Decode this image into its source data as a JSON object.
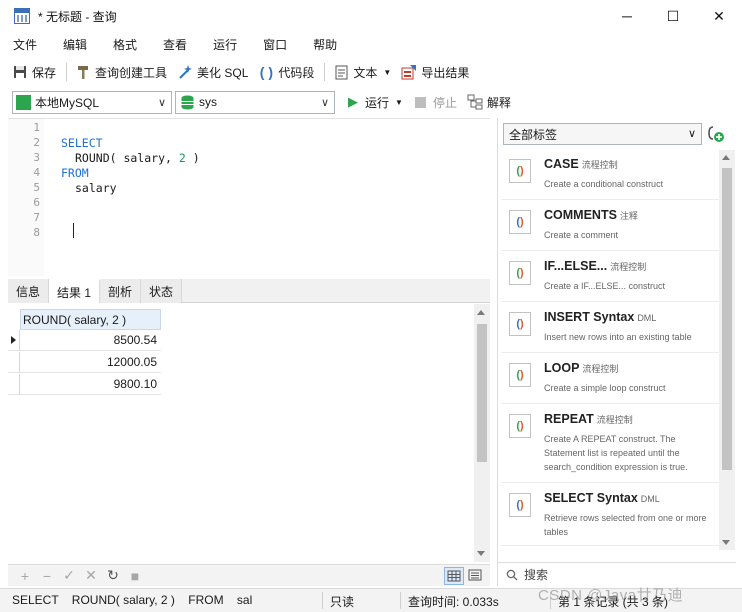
{
  "window": {
    "title": "* 无标题 - 查询",
    "minimize": "─",
    "maximize": "☐",
    "close": "✕"
  },
  "menu": [
    "文件",
    "编辑",
    "格式",
    "查看",
    "运行",
    "窗口",
    "帮助"
  ],
  "toolbar": {
    "save": "保存",
    "query_builder": "查询创建工具",
    "beautify_sql": "美化 SQL",
    "code_snippet": "代码段",
    "text": "文本",
    "export_result": "导出结果"
  },
  "toolbar2": {
    "connection": "本地MySQL",
    "database": "sys",
    "run": "运行",
    "stop": "停止",
    "explain": "解释"
  },
  "editor": {
    "lines": [
      "1",
      "2",
      "3",
      "4",
      "5",
      "6",
      "7",
      "8"
    ],
    "code": {
      "select": "SELECT",
      "round_fn": "ROUND( salary, ",
      "round_num": "2",
      "round_close": " )",
      "from": "FROM",
      "column": "salary"
    }
  },
  "result_tabs": [
    "信息",
    "结果 1",
    "剖析",
    "状态"
  ],
  "result": {
    "column": "ROUND( salary, 2 )",
    "rows": [
      "8500.54",
      "12000.05",
      "9800.10"
    ]
  },
  "grid_toolbar": {
    "add": "+",
    "remove": "−",
    "apply": "✓",
    "discard": "✕",
    "refresh": "↻",
    "stop": "■"
  },
  "snippets_panel": {
    "filter": "全部标签",
    "search_placeholder": "搜索",
    "items": [
      {
        "name": "CASE",
        "tag": "流程控制",
        "desc": "Create a conditional construct"
      },
      {
        "name": "COMMENTS",
        "tag": "注释",
        "desc": "Create a comment"
      },
      {
        "name": "IF...ELSE...",
        "tag": "流程控制",
        "desc": "Create a IF...ELSE... construct"
      },
      {
        "name": "INSERT Syntax",
        "tag": "DML",
        "desc": "Insert new rows into an existing table"
      },
      {
        "name": "LOOP",
        "tag": "流程控制",
        "desc": "Create a simple loop construct"
      },
      {
        "name": "REPEAT",
        "tag": "流程控制",
        "desc": "Create A REPEAT construct. The Statement list is repeated until the search_condition expression is true."
      },
      {
        "name": "SELECT Syntax",
        "tag": "DML",
        "desc": "Retrieve rows selected from one or more tables"
      }
    ]
  },
  "status": {
    "sql": "SELECT    ROUND( salary, 2 )    FROM    sal",
    "readonly": "只读",
    "query_time": "查询时间: 0.033s",
    "records": "第 1 条记录 (共 3 条)"
  },
  "watermark": "CSDN @Java廿乃迪"
}
